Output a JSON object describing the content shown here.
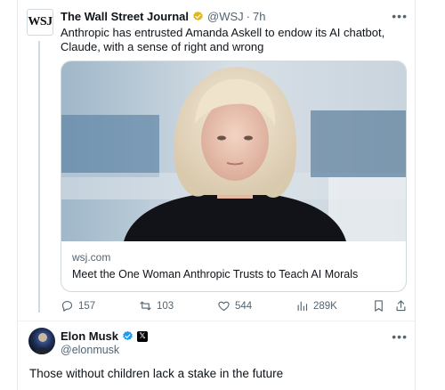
{
  "wsj_tweet": {
    "avatar_text": "WSJ",
    "name": "The Wall Street Journal",
    "handle": "@WSJ",
    "separator": "·",
    "time": "7h",
    "text": "Anthropic has entrusted Amanda Askell to endow its AI chatbot, Claude, with a sense of right and wrong",
    "card": {
      "domain": "wsj.com",
      "title": "Meet the One Woman Anthropic Trusts to Teach AI Morals"
    },
    "actions": {
      "replies": "157",
      "reposts": "103",
      "likes": "544",
      "views": "289K"
    }
  },
  "elon_tweet": {
    "name": "Elon Musk",
    "handle": "@elonmusk",
    "text": "Those without children lack a stake in the future"
  },
  "colors": {
    "secondary_text": "#536471",
    "verified_gold": "#e2b719",
    "verified_blue": "#1d9bf0",
    "border": "#cfd9de"
  }
}
